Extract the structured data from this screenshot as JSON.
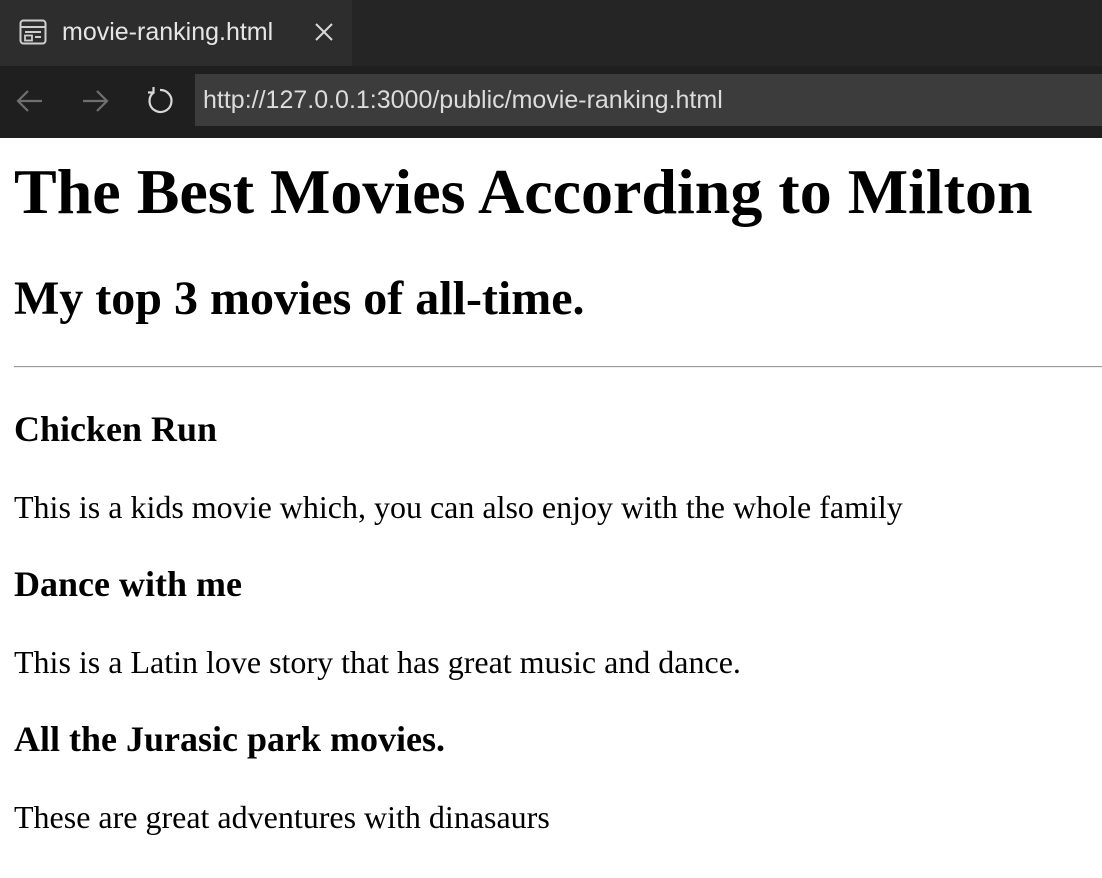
{
  "tab": {
    "title": "movie-ranking.html",
    "icon": "page-icon"
  },
  "nav": {
    "back_icon": "arrow-left-icon",
    "forward_icon": "arrow-right-icon",
    "reload_icon": "reload-icon",
    "url": "http://127.0.0.1:3000/public/movie-ranking.html"
  },
  "page": {
    "heading": "The Best Movies According to Milton",
    "subheading": "My top 3 movies of all-time.",
    "movies": [
      {
        "title": "Chicken Run",
        "description": "This is a kids movie which, you can also enjoy with the whole family"
      },
      {
        "title": "Dance with me",
        "description": "This is a Latin love story that has great music and dance."
      },
      {
        "title": "All the Jurasic park movies.",
        "description": "These are great adventures with dinasaurs"
      }
    ]
  },
  "colors": {
    "tab_strip": "#252526",
    "active_tab": "#2d2d2d",
    "nav_bar": "#1f1f1f",
    "address_bar": "#3c3c3c",
    "page_background": "#ffffff"
  }
}
